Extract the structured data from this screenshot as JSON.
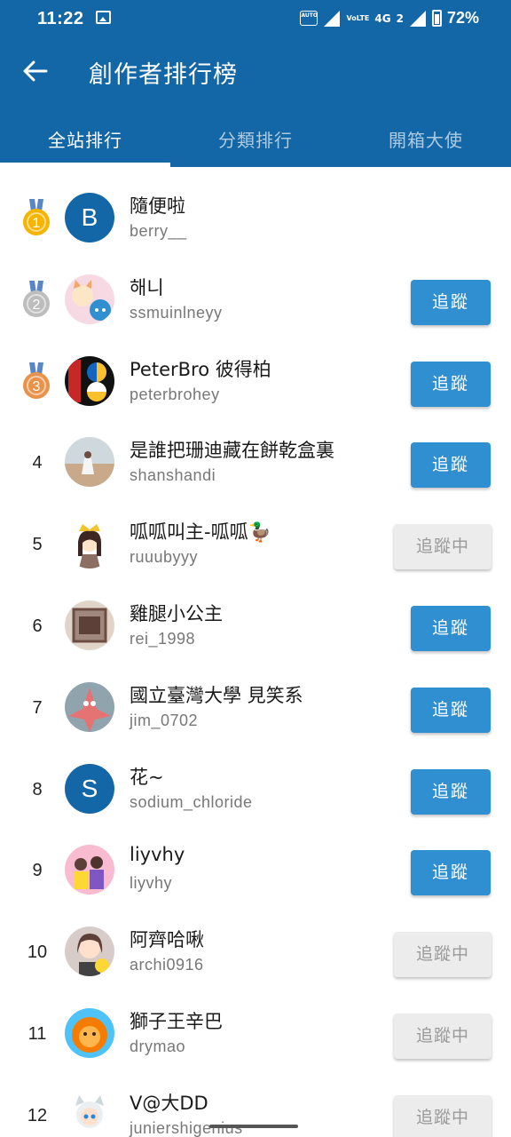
{
  "status_bar": {
    "time": "11:22",
    "battery": "72%",
    "network": "4G",
    "sim_badge": "2",
    "auto_badge": "AUTO",
    "volte": "VoLTE"
  },
  "header": {
    "title": "創作者排行榜",
    "tabs": [
      {
        "label": "全站排行",
        "selected": true
      },
      {
        "label": "分類排行",
        "selected": false
      },
      {
        "label": "開箱大使",
        "selected": false
      }
    ]
  },
  "colors": {
    "primary": "#1467a6",
    "follow_button": "#2f8fd1",
    "following_button": "#ececec",
    "gold": "#f4b400",
    "silver": "#bdbdbd",
    "bronze": "#e8924a"
  },
  "rankings": [
    {
      "rank": "1",
      "medal": "gold",
      "name": "隨便啦",
      "handle": "berry__",
      "avatar": "letter",
      "avatar_letter": "B",
      "button": ""
    },
    {
      "rank": "2",
      "medal": "silver",
      "name": "해니",
      "handle": "ssmuinlneyy",
      "avatar": "cat-illustration",
      "button": "追蹤"
    },
    {
      "rank": "3",
      "medal": "bronze",
      "name": "PeterBro 彼得柏",
      "handle": "peterbrohey",
      "avatar": "geometric-pattern",
      "button": "追蹤"
    },
    {
      "rank": "4",
      "medal": "",
      "name": "是誰把珊迪藏在餅乾盒裏",
      "handle": "shanshandi",
      "avatar": "beach-photo",
      "button": "追蹤"
    },
    {
      "rank": "5",
      "medal": "",
      "name": "呱呱叫主-呱呱🦆",
      "handle": "ruuubyyy",
      "avatar": "princess-illustration",
      "button": "追蹤中"
    },
    {
      "rank": "6",
      "medal": "",
      "name": "雞腿小公主",
      "handle": "rei_1998",
      "avatar": "framed-photo",
      "button": "追蹤"
    },
    {
      "rank": "7",
      "medal": "",
      "name": "國立臺灣大學 見笑系",
      "handle": "jim_0702",
      "avatar": "starfish-cartoon",
      "button": "追蹤"
    },
    {
      "rank": "8",
      "medal": "",
      "name": "花~",
      "handle": "sodium_chloride",
      "avatar": "letter",
      "avatar_letter": "S",
      "button": "追蹤"
    },
    {
      "rank": "9",
      "medal": "",
      "name": "liyvhy",
      "handle": "liyvhy",
      "avatar": "group-photo",
      "button": "追蹤"
    },
    {
      "rank": "10",
      "medal": "",
      "name": "阿齊哈啾",
      "handle": "archi0916",
      "avatar": "anime-girl",
      "button": "追蹤中"
    },
    {
      "rank": "11",
      "medal": "",
      "name": "獅子王辛巴",
      "handle": "drymao",
      "avatar": "lion-cartoon",
      "button": "追蹤中"
    },
    {
      "rank": "12",
      "medal": "",
      "name": "V@大DD",
      "handle": "juniershigenius",
      "avatar": "chibi-character",
      "button": "追蹤中"
    }
  ]
}
